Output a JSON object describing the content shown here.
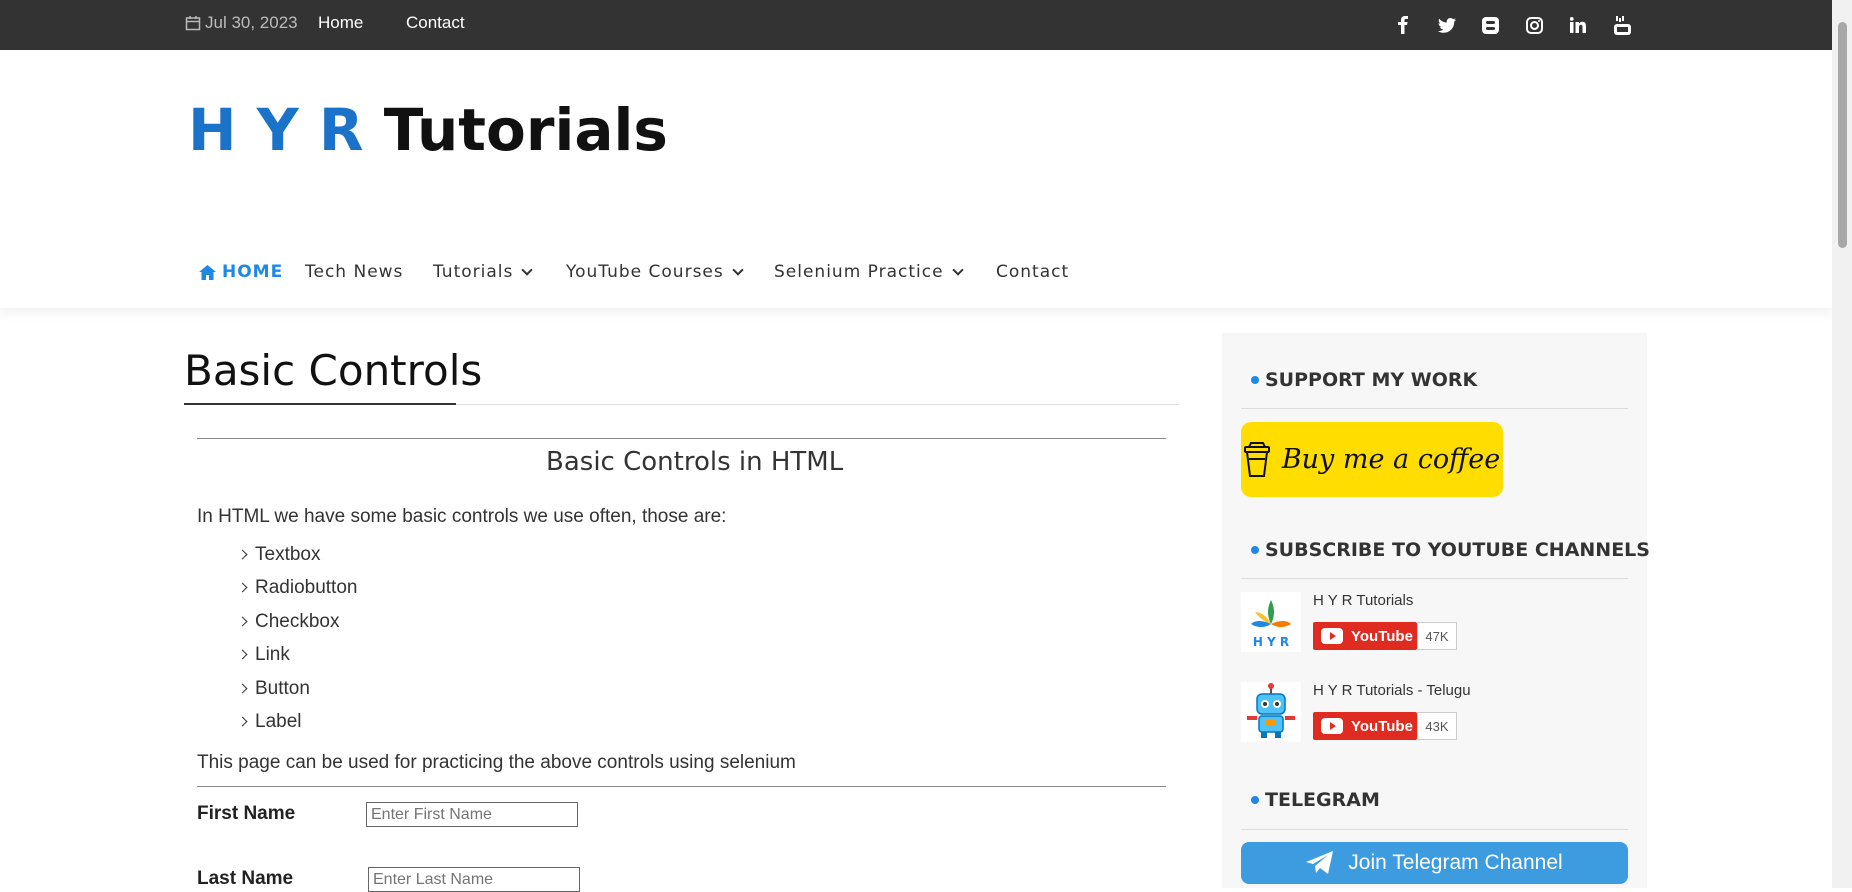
{
  "topbar": {
    "date": "Jul 30, 2023",
    "links": [
      "Home",
      "Contact"
    ],
    "social_icons": [
      "facebook-icon",
      "twitter-icon",
      "blogger-icon",
      "instagram-icon",
      "linkedin-icon",
      "youtube-icon"
    ]
  },
  "header": {
    "logo_part1": "H Y R ",
    "logo_part2": "Tutorials"
  },
  "nav": {
    "home": "HOME",
    "tech_news": "Tech News",
    "tutorials": "Tutorials",
    "youtube_courses": "YouTube Courses",
    "selenium_practice": "Selenium Practice",
    "contact": "Contact"
  },
  "main": {
    "title": "Basic Controls",
    "subtitle": "Basic Controls in HTML",
    "intro": "In HTML we have some basic controls we use often, those are:",
    "controls": [
      "Textbox",
      "Radiobutton",
      "Checkbox",
      "Link",
      "Button",
      "Label"
    ],
    "note": "This page can be used for practicing the above controls using selenium",
    "form": {
      "first_name_label": "First Name",
      "first_name_placeholder": "Enter First Name",
      "last_name_label": "Last Name",
      "last_name_placeholder": "Enter Last Name"
    }
  },
  "sidebar": {
    "support_title": "SUPPORT MY WORK",
    "coffee_label": "Buy me a coffee",
    "subscribe_title": "SUBSCRIBE TO YOUTUBE CHANNELS",
    "channels": [
      {
        "name": "H Y R Tutorials",
        "button": "YouTube",
        "count": "47K"
      },
      {
        "name": "H Y R Tutorials - Telugu",
        "button": "YouTube",
        "count": "43K"
      }
    ],
    "telegram_title": "TELEGRAM",
    "telegram_button": "Join Telegram Channel"
  },
  "colors": {
    "topbar": "#333333",
    "accent_blue": "#1e88e5",
    "coffee_yellow": "#ffdd00",
    "youtube_red": "#e02b20",
    "telegram_blue": "#3d9be0"
  }
}
